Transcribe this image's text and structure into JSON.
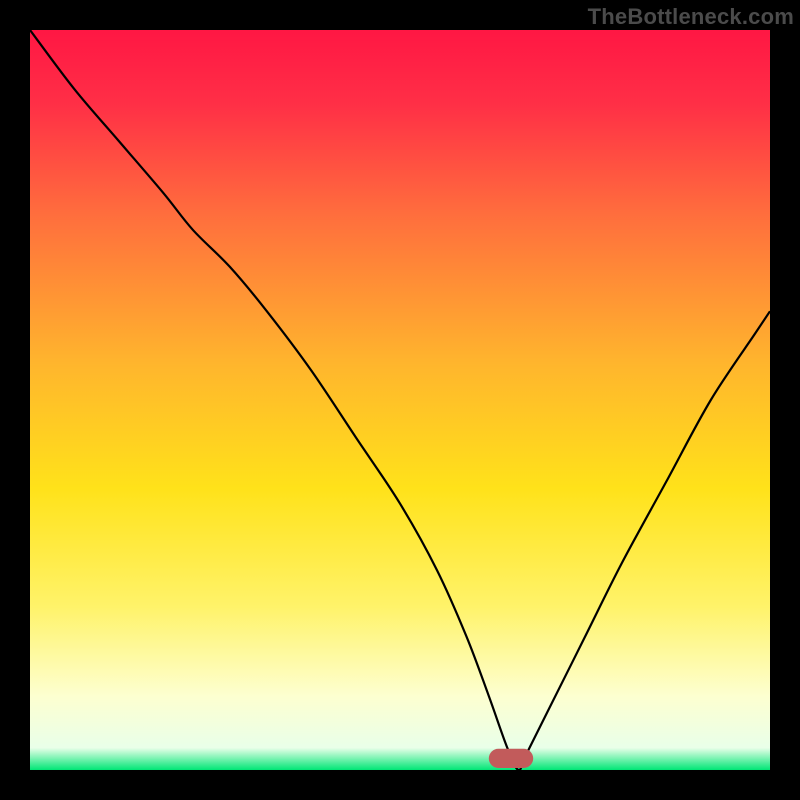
{
  "watermark": "TheBottleneck.com",
  "chart_data": {
    "type": "line",
    "title": "",
    "xlabel": "",
    "ylabel": "",
    "xlim": [
      0,
      100
    ],
    "ylim": [
      0,
      100
    ],
    "legend": false,
    "grid": false,
    "background_gradient": [
      {
        "pos": 0.0,
        "color": "#ff1744"
      },
      {
        "pos": 0.1,
        "color": "#ff2f46"
      },
      {
        "pos": 0.25,
        "color": "#ff6e3d"
      },
      {
        "pos": 0.45,
        "color": "#ffb52d"
      },
      {
        "pos": 0.62,
        "color": "#ffe21a"
      },
      {
        "pos": 0.78,
        "color": "#fff36a"
      },
      {
        "pos": 0.9,
        "color": "#fdffd0"
      },
      {
        "pos": 0.97,
        "color": "#e9ffe9"
      },
      {
        "pos": 1.0,
        "color": "#00e676"
      }
    ],
    "series": [
      {
        "name": "bottleneck-curve",
        "color": "#000000",
        "x": [
          0,
          6,
          12,
          18,
          22,
          27,
          32,
          38,
          44,
          50,
          55,
          59,
          62,
          64.5,
          66,
          67,
          70,
          75,
          80,
          86,
          92,
          98,
          100
        ],
        "y": [
          100,
          92,
          85,
          78,
          73,
          68,
          62,
          54,
          45,
          36,
          27,
          18,
          10,
          3,
          0,
          2,
          8,
          18,
          28,
          39,
          50,
          59,
          62
        ]
      }
    ],
    "marker": {
      "name": "optimal-marker",
      "color": "#c25b5b",
      "x": 65,
      "width": 6,
      "height": 2.6
    }
  }
}
